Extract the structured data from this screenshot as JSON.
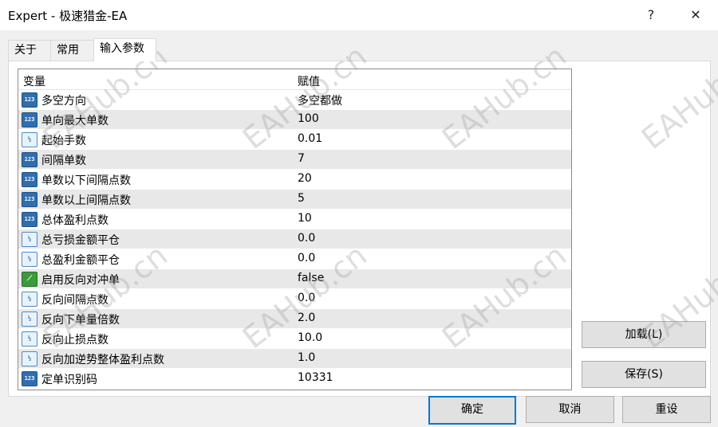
{
  "window": {
    "title": "Expert - 极速猎金-EA",
    "help_label": "?",
    "close_label": "✕"
  },
  "tabs": [
    {
      "label": "关于"
    },
    {
      "label": "常用"
    },
    {
      "label": "输入参数"
    }
  ],
  "grid": {
    "header": {
      "name": "变量",
      "value": "赋值"
    },
    "rows": [
      {
        "icon": "123",
        "type": "int",
        "name": "多空方向",
        "value": "多空都做"
      },
      {
        "icon": "123",
        "type": "int",
        "name": "单向最大单数",
        "value": "100"
      },
      {
        "icon": "½",
        "type": "dbl",
        "name": "起始手数",
        "value": "0.01"
      },
      {
        "icon": "123",
        "type": "int",
        "name": "间隔单数",
        "value": "7"
      },
      {
        "icon": "123",
        "type": "int",
        "name": "单数以下间隔点数",
        "value": "20"
      },
      {
        "icon": "123",
        "type": "int",
        "name": "单数以上间隔点数",
        "value": "5"
      },
      {
        "icon": "123",
        "type": "int",
        "name": "总体盈利点数",
        "value": "10"
      },
      {
        "icon": "½",
        "type": "dbl",
        "name": "总亏损金额平仓",
        "value": "0.0"
      },
      {
        "icon": "½",
        "type": "dbl",
        "name": "总盈利金额平仓",
        "value": "0.0"
      },
      {
        "icon": "⟋",
        "type": "bool",
        "name": "启用反向对冲单",
        "value": "false"
      },
      {
        "icon": "½",
        "type": "dbl",
        "name": "反向间隔点数",
        "value": "0.0"
      },
      {
        "icon": "½",
        "type": "dbl",
        "name": "反向下单量倍数",
        "value": "2.0"
      },
      {
        "icon": "½",
        "type": "dbl",
        "name": "反向止损点数",
        "value": "10.0"
      },
      {
        "icon": "½",
        "type": "dbl",
        "name": "反向加逆势整体盈利点数",
        "value": "1.0"
      },
      {
        "icon": "123",
        "type": "int",
        "name": "定单识别码",
        "value": "10331"
      }
    ]
  },
  "side_buttons": {
    "load": "加载(L)",
    "save": "保存(S)"
  },
  "footer_buttons": {
    "ok": "确定",
    "cancel": "取消",
    "reset": "重设"
  },
  "watermark": "EAHub.cn"
}
